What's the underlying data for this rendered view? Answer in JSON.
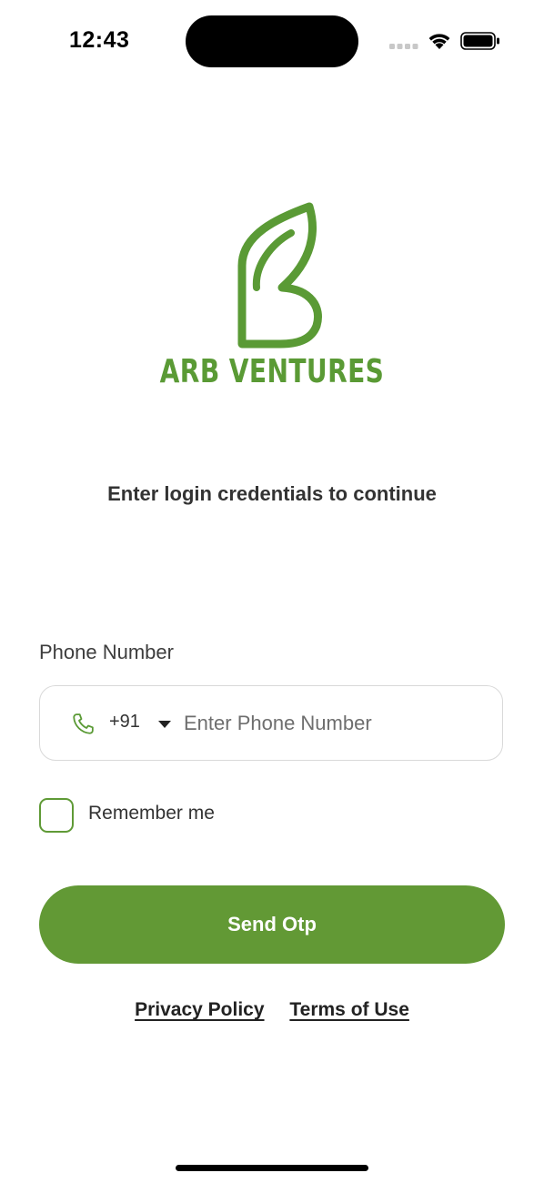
{
  "status_bar": {
    "time": "12:43"
  },
  "logo": {
    "name": "ARB VENTURES",
    "color": "#5a9a35"
  },
  "subtitle": "Enter login credentials to continue",
  "phone": {
    "label": "Phone Number",
    "country_code": "+91",
    "placeholder": "Enter Phone Number",
    "value": ""
  },
  "remember": {
    "label": "Remember me",
    "checked": false
  },
  "send_button": {
    "label": "Send Otp",
    "color": "#629935"
  },
  "links": {
    "privacy": "Privacy Policy",
    "terms": "Terms of Use"
  }
}
